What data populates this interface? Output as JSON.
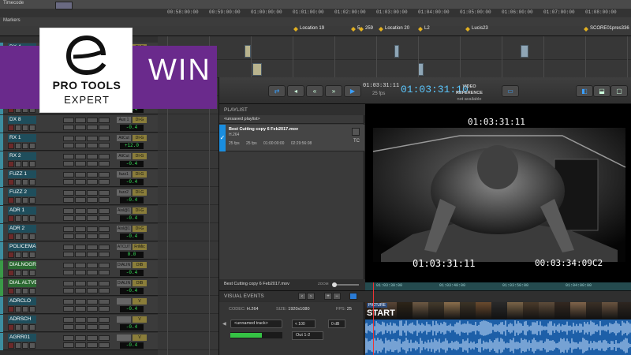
{
  "daw": {
    "ruler": {
      "row1_label": "Timecode",
      "row2_label": "Markers",
      "timecodes": [
        "00:58:00:00",
        "00:59:00:00",
        "01:00:00:00",
        "01:01:00:00",
        "01:02:00:00",
        "01:03:00:00",
        "01:04:00:00",
        "01:05:00:00",
        "01:06:00:00",
        "01:07:00:00",
        "01:08:00:00"
      ],
      "markers": [
        "Location 19",
        "5",
        "259",
        "Location 20",
        "L2",
        "Lucis23",
        "SCORE01pres336"
      ]
    },
    "tracks": [
      {
        "name": "DX 4",
        "vol": "-0.4",
        "send": "Aux 1",
        "ins": "DI-G",
        "color": "#3d8ea0"
      },
      {
        "name": "DX 5",
        "vol": "-0.4",
        "send": "Aux 1",
        "ins": "DI-G",
        "color": "#3d8ea0"
      },
      {
        "name": "DX 6",
        "vol": "-0.4",
        "send": "Aux 1",
        "ins": "DI-G",
        "color": "#3d8ea0"
      },
      {
        "name": "DX 7",
        "vol": "-0.4",
        "send": "Aux 1",
        "ins": "DI-G",
        "color": "#3d8ea0"
      },
      {
        "name": "DX 8",
        "vol": "-0.4",
        "send": "Aux 1",
        "ins": "DI-G",
        "color": "#3d8ea0"
      },
      {
        "name": "RX 1",
        "vol": "+12.0",
        "send": "AltCut",
        "ins": "DI-G",
        "color": "#3d8ea0"
      },
      {
        "name": "RX 2",
        "vol": "-0.4",
        "send": "AltCut",
        "ins": "DI-G",
        "color": "#3d8ea0"
      },
      {
        "name": "FUZZ 1",
        "vol": "-0.4",
        "send": "fuzz1",
        "ins": "DI-G",
        "color": "#3d8ea0"
      },
      {
        "name": "FUZZ 2",
        "vol": "-0.4",
        "send": "fuzz2",
        "ins": "DI-G",
        "color": "#3d8ea0"
      },
      {
        "name": "ADR 1",
        "vol": "-0.4",
        "send": "Aisl@1",
        "ins": "DI-G",
        "color": "#3d8ea0"
      },
      {
        "name": "ADR 2",
        "vol": "-0.4",
        "send": "Aisl@1",
        "ins": "DI-G",
        "color": "#3d8ea0"
      },
      {
        "name": "POLICEMAN",
        "vol": "0.0",
        "send": "ATCUT",
        "ins": "FriMic",
        "color": "#3d8ea0"
      },
      {
        "name": "DIALNOGRVERB",
        "vol": "-0.4",
        "send": "DIALIN",
        "ins": "DIB",
        "color": "#3a9a48"
      },
      {
        "name": "DIAL ALTVERB",
        "vol": "-0.4",
        "send": "DIALIN",
        "ins": "DIB",
        "color": "#3a9a48"
      },
      {
        "name": "ADRCLO",
        "vol": "-0.4",
        "send": "",
        "ins": "V",
        "color": "#3d8ea0"
      },
      {
        "name": "ADRSCH",
        "vol": "-0.4",
        "send": "",
        "ins": "V",
        "color": "#3d8ea0"
      },
      {
        "name": "AGRR01",
        "vol": "-0.4",
        "send": "",
        "ins": "V",
        "color": "#3d8ea0"
      }
    ]
  },
  "promo": {
    "logo_line1": "PRO TOOLS",
    "logo_line2": "EXPERT",
    "win": "WIN",
    "banner_color": "#6a2a8c"
  },
  "video_window": {
    "toolbar": {
      "tc_small": "01:03:31:11",
      "fps_small": "25 fps",
      "tc_big": "01:03:31:10",
      "vref_title": "VIDEO REFERENCE",
      "vref_status": "not available"
    },
    "playlist": {
      "header": "PLAYLIST",
      "subheader": "<unsaved playlist>",
      "item": {
        "name": "Best Cutting copy 6 Feb2017.mov",
        "codec": "H.264",
        "fps": "25 fps",
        "fps2": "25 fps",
        "start": "01:00:00:00",
        "end": "02:29:56:08",
        "tc": "TC"
      },
      "bottom_name": "Best Cutting copy 6 Feb2017.mov",
      "zoom_label": "ZOOM"
    },
    "burn_in": {
      "top": "01:03:31:11",
      "bottom_left": "01:03:31:11",
      "bottom_right": "00:03:34:09C2"
    },
    "track_ruler": [
      "01:03:30:00",
      "01:03:40:00",
      "01:03:50:00",
      "01:04:00:00"
    ],
    "visual_events_label": "VISUAL EVENTS",
    "info": {
      "codec_label": "CODEC:",
      "codec": "H.264",
      "size_label": "SIZE:",
      "size": "1920x1080",
      "fps_label": "FPS:",
      "fps": "25"
    },
    "audio": {
      "track": "<unnamed track>",
      "vol": "< 100",
      "db": "0 dB",
      "output": "Out 1-2",
      "meter_level": 0.6
    },
    "thumbs": {
      "label": "PICTURE",
      "start": "START"
    }
  }
}
